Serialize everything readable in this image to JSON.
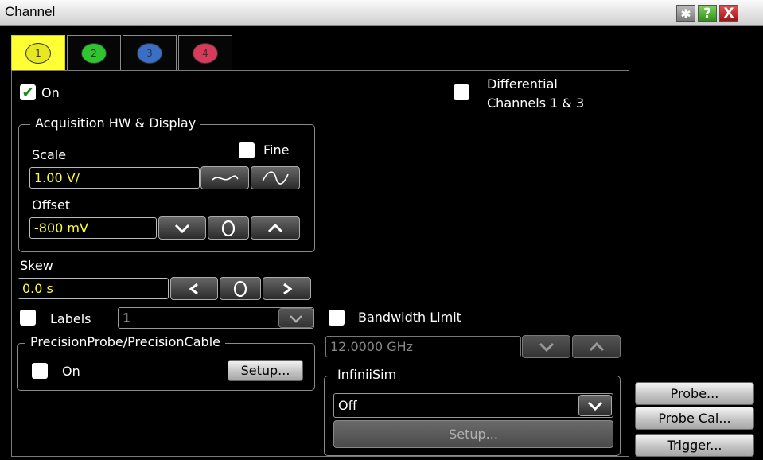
{
  "window": {
    "title": "Channel",
    "help_label": "?",
    "close_label": "X"
  },
  "tabs": [
    {
      "label": "1",
      "color": "#e8e820"
    },
    {
      "label": "2",
      "color": "#2ec52e"
    },
    {
      "label": "3",
      "color": "#3a6fc8"
    },
    {
      "label": "4",
      "color": "#d83a5a"
    }
  ],
  "on": {
    "label": "On",
    "checked": true
  },
  "differential": {
    "line1": "Differential",
    "line2": "Channels 1 & 3"
  },
  "acquisition": {
    "legend": "Acquisition HW & Display",
    "scale_label": "Scale",
    "fine_label": "Fine",
    "scale_value": "1.00 V/",
    "offset_label": "Offset",
    "offset_value": "-800 mV"
  },
  "skew": {
    "label": "Skew",
    "value": "0.0 s"
  },
  "labels": {
    "label": "Labels",
    "value": "1"
  },
  "precision": {
    "legend": "PrecisionProbe/PrecisionCable",
    "on_label": "On",
    "setup_label": "Setup..."
  },
  "bandwidth": {
    "label": "Bandwidth Limit",
    "value": "12.0000 GHz"
  },
  "infiniisim": {
    "legend": "InfiniiSim",
    "value": "Off",
    "setup_label": "Setup..."
  },
  "side_buttons": {
    "probe": "Probe...",
    "probe_cal": "Probe Cal...",
    "trigger": "Trigger..."
  }
}
